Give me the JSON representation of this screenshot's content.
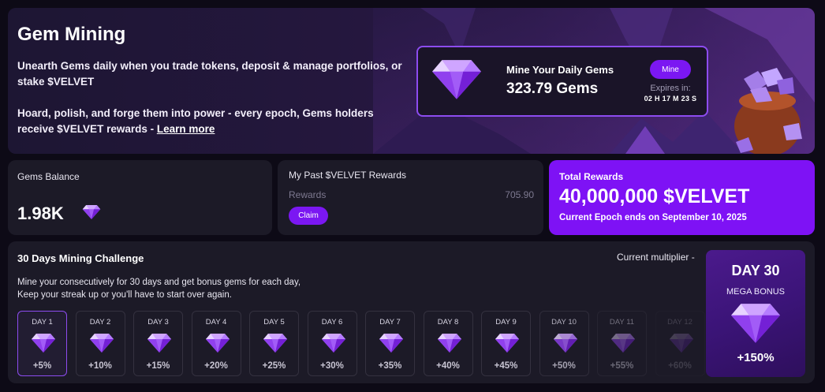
{
  "hero": {
    "title": "Gem Mining",
    "desc1": "Unearth Gems daily when you trade tokens, deposit & manage portfolios, or stake $VELVET",
    "desc2": "Hoard, polish, and forge them into power - every epoch, Gems holders receive $VELVET rewards - ",
    "learn_more": "Learn more"
  },
  "mine": {
    "title": "Mine Your Daily Gems",
    "gems": "323.79 Gems",
    "button": "Mine",
    "expires_label": "Expires in:",
    "expires_time": "02 H 17 M 23 S"
  },
  "balance": {
    "label": "Gems Balance",
    "value": "1.98K"
  },
  "past": {
    "label": "My Past $VELVET Rewards",
    "rewards_label": "Rewards",
    "rewards_value": "705.90",
    "claim": "Claim"
  },
  "total": {
    "label": "Total Rewards",
    "value": "40,000,000 $VELVET",
    "epoch": "Current Epoch ends on September 10, 2025"
  },
  "challenge": {
    "title": "30 Days Mining Challenge",
    "multiplier": "Current multiplier -",
    "desc1": "Mine your consecutively for 30 days and get bonus gems for each day,",
    "desc2": "Keep your streak up or you'll have to start over again.",
    "days": [
      {
        "label": "DAY 1",
        "bonus": "+5%"
      },
      {
        "label": "DAY 2",
        "bonus": "+10%"
      },
      {
        "label": "DAY 3",
        "bonus": "+15%"
      },
      {
        "label": "DAY 4",
        "bonus": "+20%"
      },
      {
        "label": "DAY 5",
        "bonus": "+25%"
      },
      {
        "label": "DAY 6",
        "bonus": "+30%"
      },
      {
        "label": "DAY 7",
        "bonus": "+35%"
      },
      {
        "label": "DAY 8",
        "bonus": "+40%"
      },
      {
        "label": "DAY 9",
        "bonus": "+45%"
      },
      {
        "label": "DAY 10",
        "bonus": "+50%"
      },
      {
        "label": "DAY 11",
        "bonus": "+55%"
      },
      {
        "label": "DAY 12",
        "bonus": "+60%"
      }
    ],
    "mega": {
      "day": "DAY 30",
      "label": "MEGA BONUS",
      "bonus": "+150%"
    }
  },
  "colors": {
    "accent": "#7b17f2",
    "total_card": "#7e12f5",
    "card_bg": "#1c1a27",
    "page_bg": "#0d0a16"
  },
  "icons": [
    "gem-icon",
    "gem-bag-illustration"
  ]
}
